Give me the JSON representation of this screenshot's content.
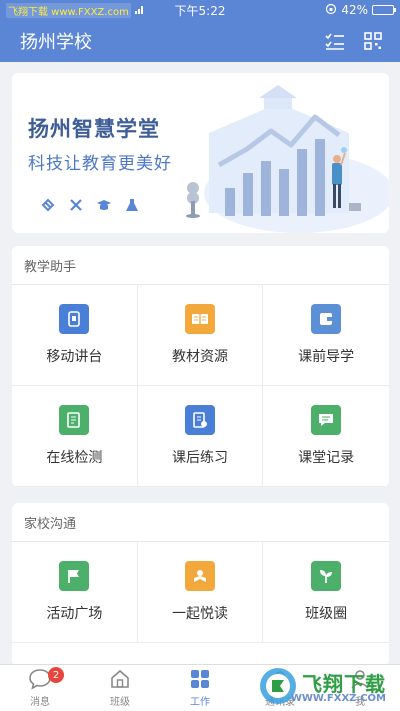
{
  "status_bar": {
    "carrier": "飞翔下载 www.FXXZ.com",
    "time": "下午5:22",
    "battery": "42%",
    "battery_level": 0.42
  },
  "header": {
    "title": "扬州学校",
    "icons": [
      "checklist-icon",
      "scan-icon"
    ]
  },
  "banner": {
    "title": "扬州智慧学堂",
    "subtitle": "科技让教育更美好",
    "mini_icons": [
      "link-icon",
      "tools-icon",
      "graduation-cap-icon",
      "flask-icon"
    ]
  },
  "sections": [
    {
      "title": "教学助手",
      "items": [
        {
          "label": "移动讲台",
          "icon": "mobile-podium-icon",
          "color": "#4a7fd8"
        },
        {
          "label": "教材资源",
          "icon": "textbook-icon",
          "color": "#f2a83a"
        },
        {
          "label": "课前导学",
          "icon": "wallet-book-icon",
          "color": "#5b8fd6"
        },
        {
          "label": "在线检测",
          "icon": "document-edit-icon",
          "color": "#4caf6a"
        },
        {
          "label": "课后练习",
          "icon": "exercise-doc-icon",
          "color": "#4a7fd8"
        },
        {
          "label": "课堂记录",
          "icon": "chat-record-icon",
          "color": "#4caf6a"
        }
      ]
    },
    {
      "title": "家校沟通",
      "items": [
        {
          "label": "活动广场",
          "icon": "flag-icon",
          "color": "#4caf6a"
        },
        {
          "label": "一起悦读",
          "icon": "reading-icon",
          "color": "#f2a83a"
        },
        {
          "label": "班级圈",
          "icon": "sprout-icon",
          "color": "#4caf6a"
        }
      ]
    }
  ],
  "tabs": [
    {
      "label": "消息",
      "icon": "chat-bubble-icon",
      "badge": "2"
    },
    {
      "label": "班级",
      "icon": "home-icon"
    },
    {
      "label": "工作",
      "icon": "grid-apps-icon",
      "active": true
    },
    {
      "label": "通讯录",
      "icon": "contacts-icon"
    },
    {
      "label": "我",
      "icon": "person-icon"
    }
  ],
  "watermark": {
    "text": "飞翔下载",
    "site": "WWW.FXXZ.COM"
  },
  "colors": {
    "primary": "#5b86d6",
    "background": "#f0f1f4",
    "badge": "#e8453c"
  }
}
